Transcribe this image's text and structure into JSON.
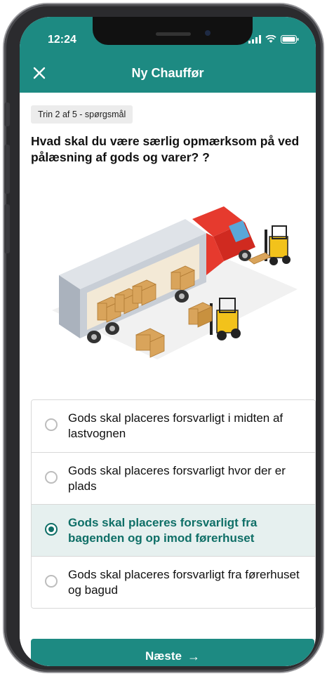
{
  "status_bar": {
    "time": "12:24"
  },
  "header": {
    "title": "Ny Chauffør"
  },
  "step": {
    "label": "Trin 2 af 5 - spørgsmål"
  },
  "question": {
    "text": "Hvad skal du være særlig opmærksom på ved pålæsning af gods og varer? ?"
  },
  "options": [
    {
      "text": "Gods skal placeres forsvarligt i midten af lastvognen",
      "selected": false
    },
    {
      "text": "Gods skal placeres forsvarligt hvor der er plads",
      "selected": false
    },
    {
      "text": "Gods skal placeres forsvarligt fra bagenden og op imod førerhuset",
      "selected": true
    },
    {
      "text": "Gods skal placeres forsvarligt fra førerhuset og bagud",
      "selected": false
    }
  ],
  "footer": {
    "next_label": "Næste",
    "next_icon": "→"
  },
  "colors": {
    "primary": "#1d8a82",
    "selected_text": "#0f6f67",
    "selected_bg": "#e6f0ef"
  }
}
